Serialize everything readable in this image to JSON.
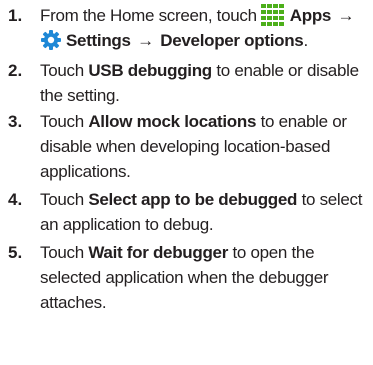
{
  "steps": [
    {
      "number": "1.",
      "line1_prefix": "From the Home screen, touch",
      "apps_label": "Apps",
      "arrow1": "→",
      "settings_label": "Settings",
      "arrow2": "→",
      "developer_label": "Developer options",
      "end": ".",
      "icons": [
        "apps-grid-icon",
        "settings-gear-icon"
      ]
    },
    {
      "number": "2.",
      "prefix": "Touch",
      "bold": "USB debugging",
      "suffix": "to enable or disable the setting."
    },
    {
      "number": "3.",
      "prefix": "Touch",
      "bold": "Allow mock locations",
      "suffix": "to enable or disable when developing location-based applications."
    },
    {
      "number": "4.",
      "prefix": "Touch",
      "bold": "Select app to be debugged",
      "suffix": "to select an application to debug."
    },
    {
      "number": "5.",
      "prefix": "Touch",
      "bold": "Wait for debugger",
      "suffix": "to open the selected application when the debugger attaches."
    }
  ],
  "colors": {
    "text": "#231f20",
    "apps_icon": "#4caf1a",
    "settings_icon": "#1e88d6"
  }
}
